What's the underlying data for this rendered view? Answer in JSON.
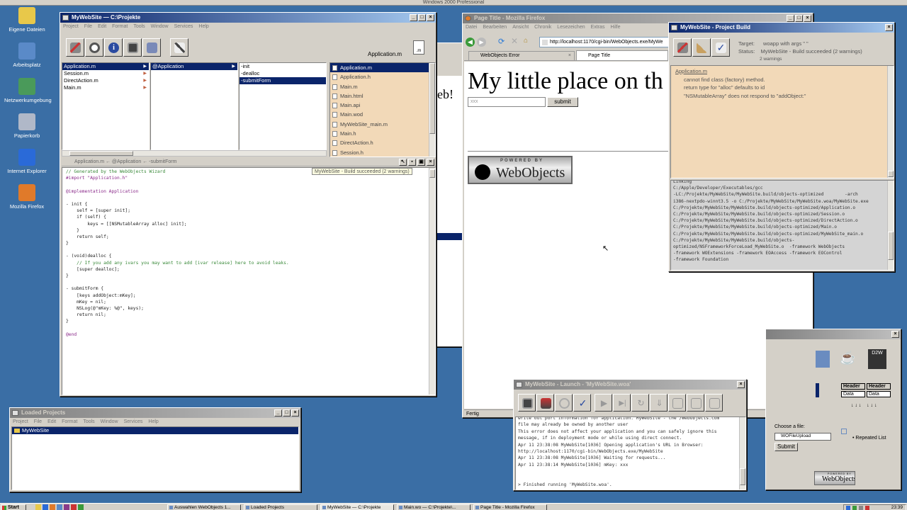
{
  "os_title": "Windows 2000 Professional",
  "desktop": {
    "icons": [
      {
        "label": "Eigene Dateien",
        "color": "#e8c84a"
      },
      {
        "label": "Arbeitsplatz",
        "color": "#5a8ac8"
      },
      {
        "label": "Netzwerkumgebung",
        "color": "#4a9a5a"
      },
      {
        "label": "Papierkorb",
        "color": "#b0b8c8"
      },
      {
        "label": "Internet Explorer",
        "color": "#2a6ad8"
      },
      {
        "label": "Mozilla Firefox",
        "color": "#e07a2a"
      }
    ]
  },
  "pb": {
    "title": "MyWebSite — C:\\Projekte",
    "menu": [
      "Project",
      "File",
      "Edit",
      "Format",
      "Tools",
      "Window",
      "Services",
      "Help"
    ],
    "current_file": "Application.m",
    "col1": [
      "Application.m",
      "Session.m",
      "DirectAction.m",
      "Main.m"
    ],
    "col2": [
      "@Application"
    ],
    "col3": [
      "-init",
      "-dealloc",
      "-submitForm"
    ],
    "files": [
      "Application.m",
      "Application.h",
      "Main.m",
      "Main.html",
      "Main.api",
      "Main.wod",
      "MyWebSite_main.m",
      "Main.h",
      "DirectAction.h",
      "Session.h"
    ],
    "editor_path": "Application.m ← @Application ← -submitForm",
    "build_status": "MyWebSite - Build succeeded (2 warnings)",
    "code": [
      "// Generated by the WebObjects Wizard",
      "#import \"Application.h\"",
      "",
      "@implementation Application",
      "",
      "- init {",
      "    self = [super init];",
      "    if (self) {",
      "        keys = [[NSMutableArray alloc] init];",
      "    }",
      "    return self;",
      "}",
      "",
      "- (void)dealloc {",
      "    // If you add any ivars you may want to add [ivar release] here to avoid leaks.",
      "    [super dealloc];",
      "}",
      "",
      "- submitForm {",
      "    [keys addObject:mKey];",
      "    mKey = nil;",
      "    NSLog(@\"mKey: %@\", keys);",
      "    return nil;",
      "}",
      "",
      "@end"
    ]
  },
  "lp": {
    "title": "Loaded Projects",
    "menu": [
      "Project",
      "File",
      "Edit",
      "Format",
      "Tools",
      "Window",
      "Services",
      "Help"
    ],
    "project": "MyWebSite"
  },
  "ff": {
    "title": "Page Title - Mozilla Firefox",
    "menu": [
      "Datei",
      "Bearbeiten",
      "Ansicht",
      "Chronik",
      "Lesezeichen",
      "Extras",
      "Hilfe"
    ],
    "url": "http://localhost:1170/cgi-bin/WebObjects.exe/MyWe",
    "tabs": [
      "WebObjects Error",
      "Page Title"
    ],
    "heading": "My little place on th",
    "input_value": "xxx",
    "submit": "submit",
    "powered_small": "POWERED BY",
    "powered_big": "WebObjects",
    "status": "Fertig"
  },
  "build": {
    "title": "MyWebSite - Project Build",
    "target_label": "Target:",
    "target_value": "woapp with args \" \"",
    "status_label": "Status:",
    "status_value": "MyWebSite - Build succeeded (2 warnings)",
    "warnings": "2 warnings",
    "warn_file": "Application.m",
    "warn_lines": [
      "cannot find class (factory) method.",
      "return type for \"alloc\" defaults to id",
      "\"NSMutableArray\" does not respond to \"addObject:\""
    ],
    "log": [
      "Linking",
      "C:/Apple/Developer/Executables/gcc",
      "-LC:/Projekte/MyWebSite/MyWebSite.build/objects-optimized        -arch",
      "i386-nextpdo-winnt3.5 -o C:/Projekte/MyWebSite/MyWebSite.woa/MyWebSite.exe",
      "C:/Projekte/MyWebSite/MyWebSite.build/objects-optimized/Application.o",
      "C:/Projekte/MyWebSite/MyWebSite.build/objects-optimized/Session.o",
      "C:/Projekte/MyWebSite/MyWebSite.build/objects-optimized/DirectAction.o",
      "C:/Projekte/MyWebSite/MyWebSite.build/objects-optimized/Main.o",
      "C:/Projekte/MyWebSite/MyWebSite.build/objects-optimized/MyWebSite_main.o",
      "C:/Projekte/MyWebSite/MyWebSite.build/objects-",
      "optimized/NSFrameworkForceLoad_MyWebSite.o  -framework WebObjects",
      "-framework WOExtensions -framework EOAccess -framework EOControl",
      "-framework Foundation"
    ]
  },
  "launch": {
    "title": "MyWebSite - Launch - 'MyWebSite.woa'",
    "log": [
      "write out port information for application. MyWebSite - the /WebObjects.com",
      "file may already be owned by another user",
      "This error does not affect your application and you can safely ignore this",
      "message, if in deployment mode or while using direct connect.",
      "Apr 11 23:38:08 MyWebSite[1036] Opening application's URL in Browser:",
      "http://localhost:1170/cgi-bin/WebObjects.exe/MyWebSite",
      "Apr 11 23:38:08 MyWebSite[1036] Waiting for requests...",
      "Apr 11 23:38:14 MyWebSite[1036] mKey: xxx",
      "",
      "",
      "> Finished running 'MyWebSite.woa'."
    ]
  },
  "palette": {
    "header1": "Header",
    "header2": "Header",
    "data1": "Data",
    "data2": "Data",
    "choose_file": "Choose a file:",
    "file_field": "WOFileUpload",
    "submit": "Submit",
    "repeated": "Repeated List",
    "d2w": "D2W",
    "powered_small": "POWERED BY",
    "powered_big": "WebObjects"
  },
  "bg_window": {
    "label": "eb!"
  },
  "taskbar": {
    "start": "Start",
    "tasks": [
      "Auswahlen WebObjects 1...",
      "Loaded Projects",
      "MyWebSite — C:\\Projekte",
      "Main.wo — C:\\Projekte\\...",
      "Page Title - Mozilla Firefox"
    ],
    "clock": "23:39"
  }
}
